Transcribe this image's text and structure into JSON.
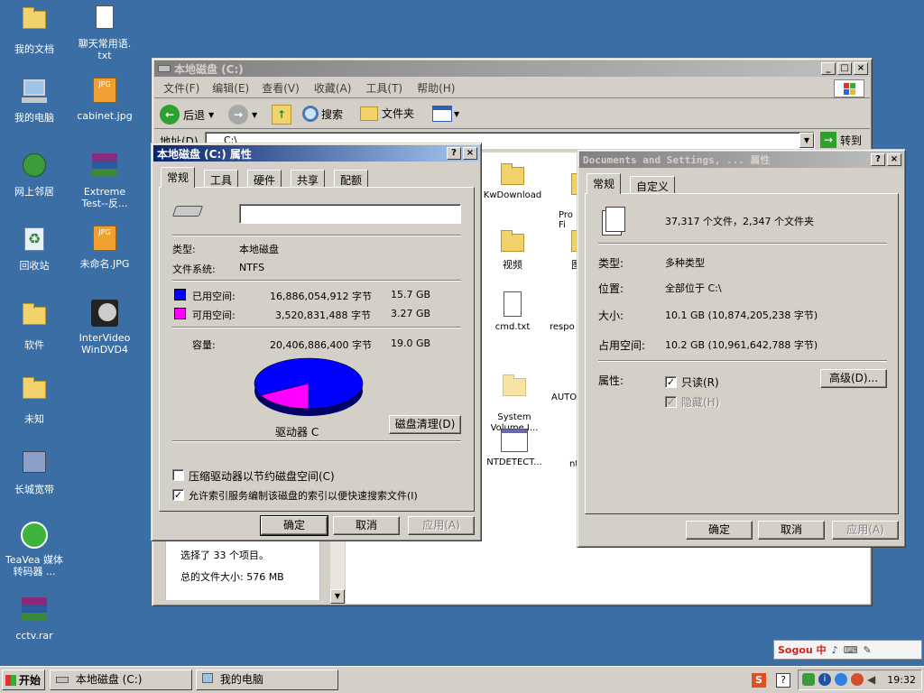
{
  "desktop": {
    "icons": [
      {
        "label": "我的文档"
      },
      {
        "label": "聊天常用语.\ntxt"
      },
      {
        "label": "我的电脑"
      },
      {
        "label": "cabinet.jpg"
      },
      {
        "label": "网上邻居"
      },
      {
        "label": "Extreme\nTest--反..."
      },
      {
        "label": "回收站"
      },
      {
        "label": "未命名.JPG"
      },
      {
        "label": "软件"
      },
      {
        "label": "InterVideo\nWinDVD4"
      },
      {
        "label": "未知"
      },
      {
        "label": "长城宽带"
      },
      {
        "label": "TeaVea 媒体\n转码器 ..."
      },
      {
        "label": "cctv.rar"
      }
    ]
  },
  "explorer": {
    "title": "本地磁盘 (C:)",
    "menu": [
      "文件(F)",
      "编辑(E)",
      "查看(V)",
      "收藏(A)",
      "工具(T)",
      "帮助(H)"
    ],
    "toolbar": {
      "back": "后退",
      "search": "搜索",
      "folders": "文件夹"
    },
    "address_label": "地址(D)",
    "address_value": "C:\\",
    "go_label": "转到",
    "files": [
      {
        "name": "KwDownload"
      },
      {
        "name": "Pro\nFi"
      },
      {
        "name": "视频"
      },
      {
        "name": "图"
      },
      {
        "name": "cmd.txt"
      },
      {
        "name": "respo"
      },
      {
        "name": "System\nVolume I..."
      },
      {
        "name": "AUTOE"
      },
      {
        "name": "NTDETECT..."
      },
      {
        "name": "nt"
      }
    ],
    "details": {
      "selected": "选择了 33 个项目。",
      "total_size": "总的文件大小: 576 MB"
    }
  },
  "disk_props": {
    "title": "本地磁盘 (C:) 属性",
    "tabs": [
      "常规",
      "工具",
      "硬件",
      "共享",
      "配额"
    ],
    "name_value": "",
    "type_label": "类型:",
    "type_value": "本地磁盘",
    "fs_label": "文件系统:",
    "fs_value": "NTFS",
    "used_label": "已用空间:",
    "used_bytes": "16,886,054,912 字节",
    "used_gb": "15.7 GB",
    "free_label": "可用空间:",
    "free_bytes": "3,520,831,488 字节",
    "free_gb": "3.27 GB",
    "cap_label": "容量:",
    "cap_bytes": "20,406,886,400 字节",
    "cap_gb": "19.0 GB",
    "used_fraction": 0.827,
    "used_color": "#0000ff",
    "free_color": "#ff00ff",
    "drive_label": "驱动器 C",
    "cleanup_button": "磁盘清理(D)",
    "compress_label": "压缩驱动器以节约磁盘空间(C)",
    "compress_checked": false,
    "index_label": "允许索引服务编制该磁盘的索引以便快速搜索文件(I)",
    "index_checked": true,
    "ok": "确定",
    "cancel": "取消",
    "apply": "应用(A)"
  },
  "folder_props": {
    "title": "Documents and Settings, ... 属性",
    "tabs": [
      "常规",
      "自定义"
    ],
    "contains": "37,317 个文件，2,347 个文件夹",
    "type_label": "类型:",
    "type_value": "多种类型",
    "location_label": "位置:",
    "location_value": "全部位于 C:\\",
    "size_label": "大小:",
    "size_value": "10.1 GB (10,874,205,238 字节)",
    "disk_label": "占用空间:",
    "disk_value": "10.2 GB (10,961,642,788 字节)",
    "attr_label": "属性:",
    "readonly_label": "只读(R)",
    "readonly_checked": true,
    "hidden_label": "隐藏(H)",
    "hidden_checked": true,
    "advanced_button": "高级(D)...",
    "ok": "确定",
    "cancel": "取消",
    "apply": "应用(A)"
  },
  "taskbar": {
    "start": "开始",
    "tasks": [
      {
        "label": "本地磁盘 (C:)"
      },
      {
        "label": "我的电脑"
      }
    ],
    "clock": "19:32"
  },
  "ime_bar": {
    "label": "Sogou 中"
  }
}
